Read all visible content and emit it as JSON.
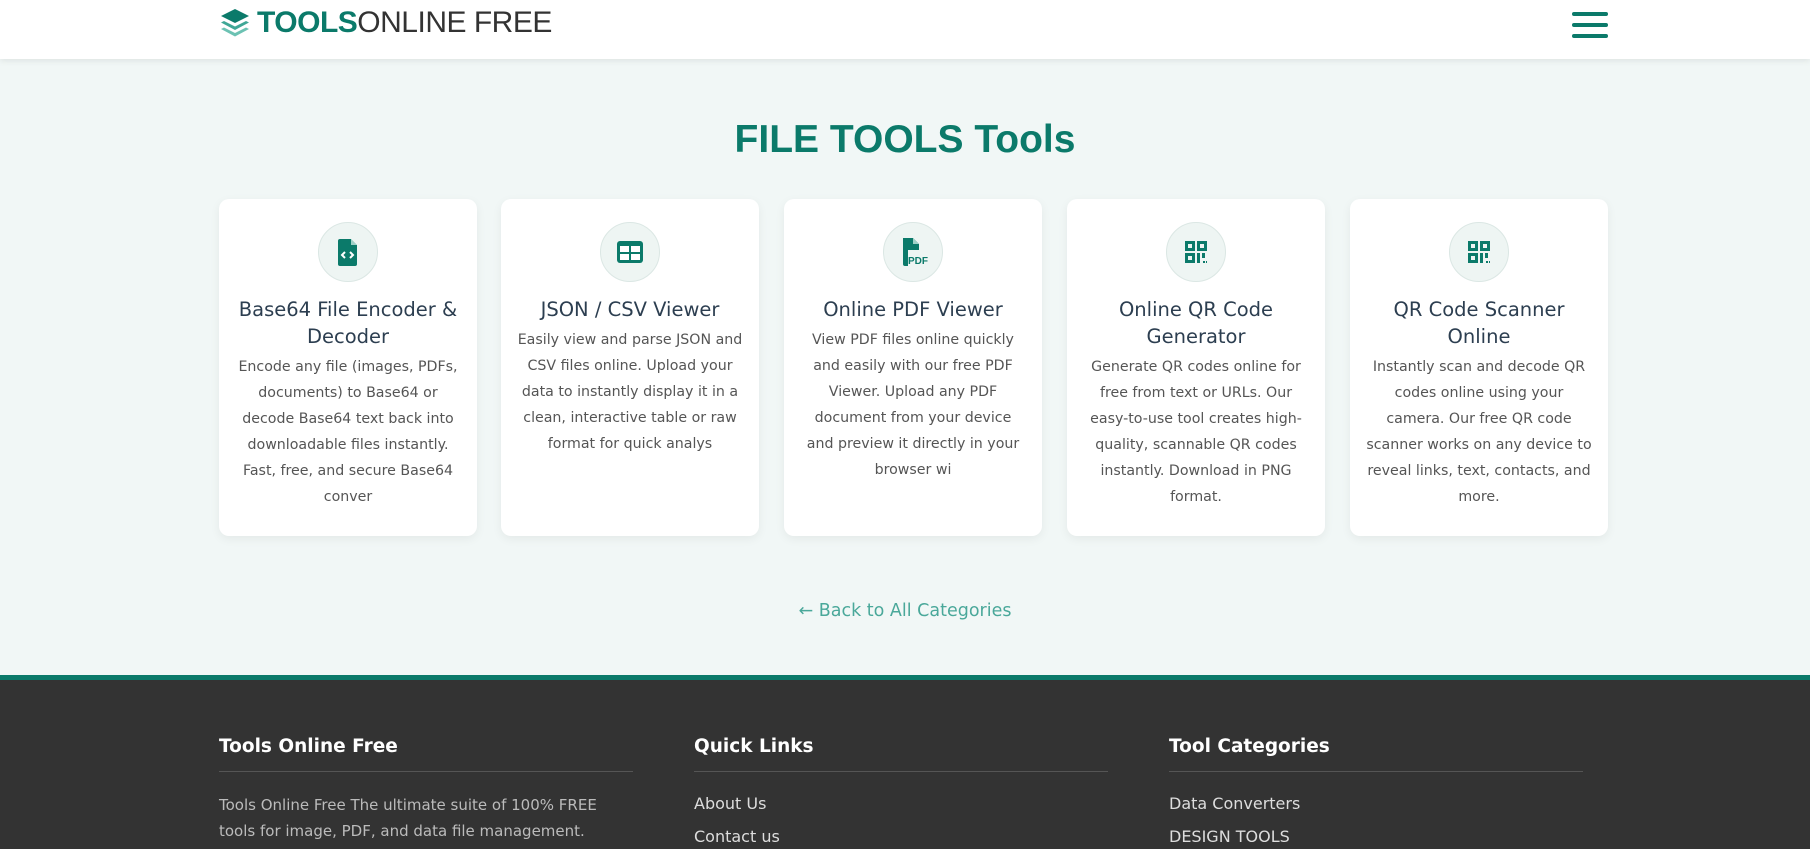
{
  "header": {
    "logo_bold": "TOOLS",
    "logo_light": "ONLINE FREE"
  },
  "page_title": "FILE TOOLS Tools",
  "cards": [
    {
      "title": "Base64 File Encoder & Decoder",
      "desc": "Encode any file (images, PDFs, documents) to Base64 or decode Base64 text back into downloadable files instantly. Fast, free, and secure Base64 conver",
      "icon": "file-code-icon"
    },
    {
      "title": "JSON / CSV Viewer",
      "desc": "Easily view and parse JSON and CSV files online. Upload your data to instantly display it in a clean, interactive table or raw format for quick analys",
      "icon": "table-icon"
    },
    {
      "title": "Online PDF Viewer",
      "desc": "View PDF files online quickly and easily with our free PDF Viewer. Upload any PDF document from your device and preview it directly in your browser wi",
      "icon": "file-pdf-icon"
    },
    {
      "title": "Online QR Code Generator",
      "desc": "Generate QR codes online for free from text or URLs. Our easy-to-use tool creates high-quality, scannable QR codes instantly. Download in PNG format.",
      "icon": "qrcode-icon"
    },
    {
      "title": "QR Code Scanner Online",
      "desc": "Instantly scan and decode QR codes online using your camera. Our free QR code scanner works on any device to reveal links, text, contacts, and more.",
      "icon": "qrcode-icon"
    }
  ],
  "back_link": "Back to All Categories",
  "footer": {
    "about": {
      "heading": "Tools Online Free",
      "text": "Tools Online Free The ultimate suite of 100% FREE tools for image, PDF, and data file management."
    },
    "quick_links": {
      "heading": "Quick Links",
      "items": [
        "About Us",
        "Contact us"
      ]
    },
    "categories": {
      "heading": "Tool Categories",
      "items": [
        "Data Converters",
        "DESIGN TOOLS"
      ]
    }
  },
  "colors": {
    "brand": "#0b7a6a",
    "footer_bg": "#333333",
    "page_bg": "#f1f7f6"
  }
}
